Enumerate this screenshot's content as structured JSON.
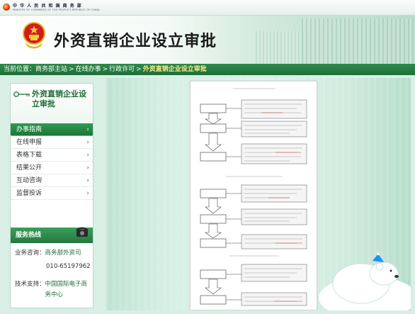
{
  "header": {
    "ministry_cn": "中 华 人 民 共 和 国 商 务 部",
    "ministry_en": "MINISTRY OF COMMERCE OF THE PEOPLE'S REPUBLIC OF CHINA",
    "title": "外资直销企业设立审批"
  },
  "breadcrumb": {
    "prefix": "当前位置：",
    "items": [
      "商务部主站",
      "在线办事",
      "行政许可"
    ],
    "separator": ">",
    "current": "外资直销企业设立审批"
  },
  "sidebar": {
    "title": "外资直销企业设立审批",
    "menu": [
      {
        "label": "办事指南",
        "active": true
      },
      {
        "label": "在线申报",
        "active": false
      },
      {
        "label": "表格下载",
        "active": false
      },
      {
        "label": "结果公开",
        "active": false
      },
      {
        "label": "互动咨询",
        "active": false
      },
      {
        "label": "监督投诉",
        "active": false
      }
    ],
    "arrow": "›",
    "hotline_title": "服务热线",
    "consult_label": "业务咨询：",
    "consult_value": "商务部外资司",
    "phone": "010-65197962",
    "tech_label": "技术支持：",
    "tech_value": "中国国际电子商务中心"
  },
  "colors": {
    "accent_green": "#1f6f39",
    "breadcrumb_current": "#ffe98a"
  }
}
